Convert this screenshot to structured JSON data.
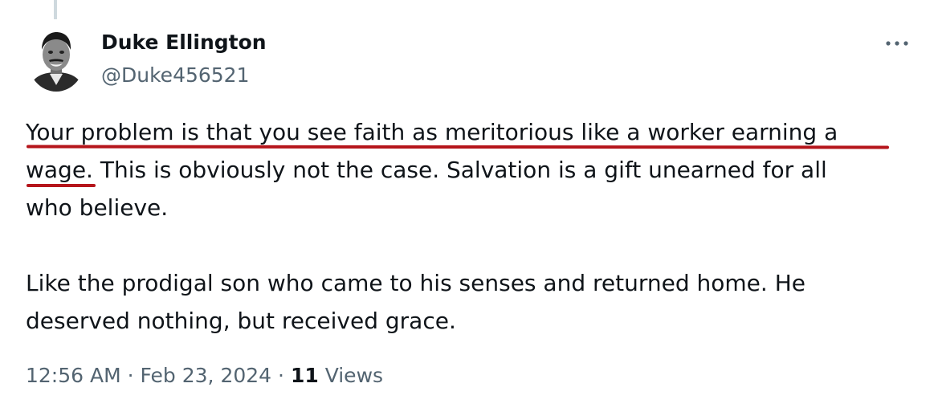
{
  "tweet": {
    "author": {
      "name": "Duke Ellington",
      "handle": "@Duke456521"
    },
    "more_icon": "more-horizontal-icon",
    "text_lines": [
      "Your problem is that you see faith as meritorious like a worker earning a",
      "wage. This is obviously not the case. Salvation is a gift unearned for all",
      "who believe.",
      "",
      "Like the prodigal son who came to his senses and returned home. He",
      "deserved nothing, but received grace."
    ],
    "meta": {
      "time": "12:56 AM",
      "separator": "·",
      "date": "Feb 23, 2024",
      "views_count": "11",
      "views_label": "Views"
    }
  },
  "colors": {
    "text": "#0f1419",
    "secondary": "#536471",
    "annotation": "#b5151b",
    "thread_line": "#cfd9de"
  }
}
